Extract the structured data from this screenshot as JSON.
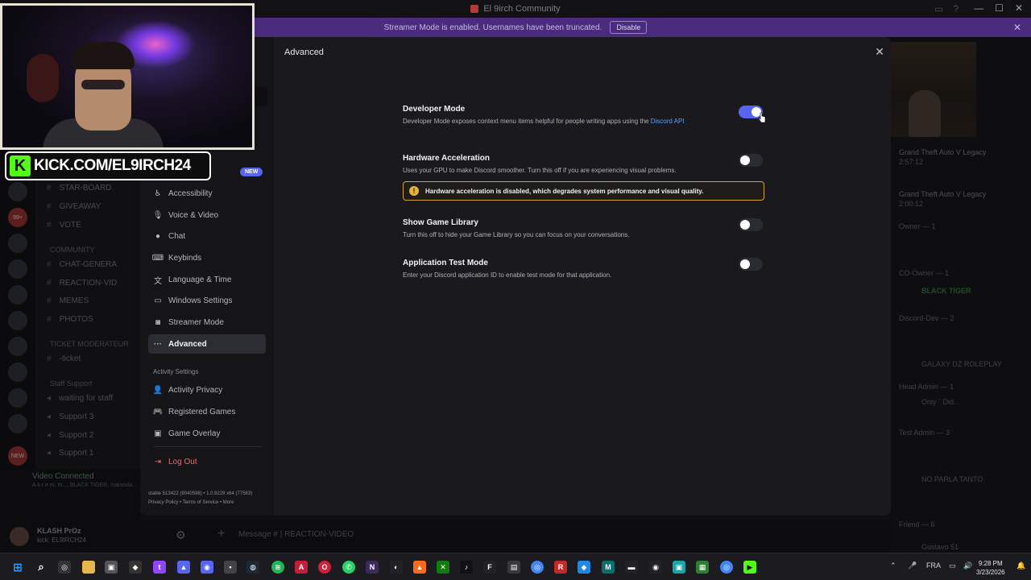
{
  "window": {
    "title": "El 9irch Community"
  },
  "banner": {
    "text": "Streamer Mode is enabled. Usernames have been truncated.",
    "disable_label": "Disable"
  },
  "webcam": {
    "kick_url": "KICK.COM/EL9IRCH24"
  },
  "channels": {
    "items": [
      {
        "label": "STAR-BOARD"
      },
      {
        "label": "GIVEAWAY"
      },
      {
        "label": "VOTE"
      },
      {
        "label": "CHAT-GENERA"
      },
      {
        "label": "REACTION-VID"
      },
      {
        "label": "MEMES"
      },
      {
        "label": "PHOTOS"
      },
      {
        "label": "-ticket"
      },
      {
        "label": "waiting for staff"
      },
      {
        "label": "Support 3"
      },
      {
        "label": "Support 2"
      },
      {
        "label": "Support 1"
      }
    ],
    "categories": [
      "COMMUNITY",
      "TICKET MODERATEUR",
      "Staff Support"
    ]
  },
  "voice": {
    "status": "Video Connected",
    "members": "A k r e m, m..., BLACK TIGER, manoula..."
  },
  "user": {
    "name": "KLASH PrOz",
    "sub": "kick: EL9IRCH24"
  },
  "chat_input": {
    "placeholder": "Message # | REACTION-VIDEO"
  },
  "members": {
    "activity": [
      {
        "game": "Grand Theft Auto V Legacy",
        "detail": "2:57:12"
      },
      {
        "game": "Grand Theft Auto V Legacy",
        "detail": "2:00:12"
      }
    ],
    "roles": [
      "Owner — 1",
      "CO-Owner — 1",
      "Discord-Dev — 2",
      "Head Admin — 1",
      "Test Admin — 3",
      "Friend — 6"
    ],
    "names": [
      "BLACK TIGER",
      "GXDZ",
      "GALAXY DZ ROLEPLAY",
      "Only ` Did...",
      "NO PARLA TANTO",
      "Gustavo 51"
    ]
  },
  "settings": {
    "page_title": "Advanced",
    "new_badge": "NEW",
    "nav": [
      {
        "label": "Accessibility",
        "icon": "accessibility-icon"
      },
      {
        "label": "Voice & Video",
        "icon": "microphone-icon"
      },
      {
        "label": "Chat",
        "icon": "chat-bubble-icon"
      },
      {
        "label": "Keybinds",
        "icon": "keyboard-icon"
      },
      {
        "label": "Language & Time",
        "icon": "language-icon"
      },
      {
        "label": "Windows Settings",
        "icon": "monitor-icon"
      },
      {
        "label": "Streamer Mode",
        "icon": "streamer-icon"
      },
      {
        "label": "Advanced",
        "icon": "ellipsis-icon"
      }
    ],
    "activity_section": "Activity Settings",
    "activity_nav": [
      {
        "label": "Activity Privacy",
        "icon": "person-icon"
      },
      {
        "label": "Registered Games",
        "icon": "gamepad-icon"
      },
      {
        "label": "Game Overlay",
        "icon": "overlay-icon"
      }
    ],
    "logout_label": "Log Out",
    "footer": {
      "build": "stable 513422 (9040598) • 1.0.9229 x64 (77563)",
      "links": "Privacy Policy • Terms of Service • More"
    },
    "options": [
      {
        "title": "Developer Mode",
        "desc": "Developer Mode exposes context menu items helpful for people writing apps using the",
        "link": "Discord API",
        "enabled": true
      },
      {
        "title": "Hardware Acceleration",
        "desc": "Uses your GPU to make Discord smoother. Turn this off if you are experiencing visual problems.",
        "enabled": false
      },
      {
        "title": "Show Game Library",
        "desc": "Turn this off to hide your Game Library so you can focus on your conversations.",
        "enabled": false
      },
      {
        "title": "Application Test Mode",
        "desc": "Enter your Discord application ID to enable test mode for that application.",
        "enabled": false
      }
    ],
    "warning": "Hardware acceleration is disabled, which degrades system performance and visual quality."
  },
  "taskbar": {
    "language": "FRA",
    "time": "9:28 PM",
    "date": "3/23/2026"
  },
  "colors": {
    "accent": "#5865f2",
    "warning": "#d2a32a",
    "danger": "#f0686d",
    "kick_green": "#53fc18"
  }
}
